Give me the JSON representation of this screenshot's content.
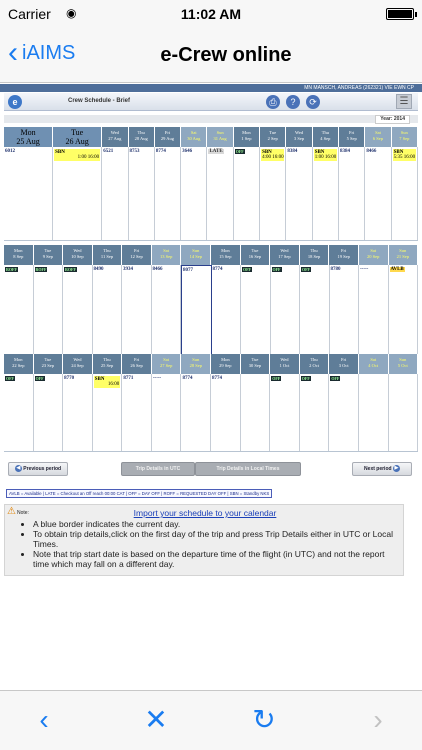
{
  "status": {
    "carrier": "Carrier",
    "time": "11:02 AM"
  },
  "nav": {
    "back_label": "iAIMS",
    "title": "e-Crew online"
  },
  "header": {
    "user_info": "MN MANSCH, ANDREAS (262321) VIE EWN CP",
    "page_title": "Crew Schedule - Brief",
    "year_label": "Year: 2014"
  },
  "weeks": [
    {
      "days": [
        {
          "d": "Mon",
          "date": "25 Aug",
          "duty": "6012",
          "type": "plain",
          "big": true
        },
        {
          "d": "Tue",
          "date": "26 Aug",
          "duty": "SBN",
          "t2": "1:00 16:00",
          "type": "sbn",
          "big": true
        },
        {
          "d": "Wed",
          "date": "27 Aug",
          "duty": "6521",
          "type": "plain"
        },
        {
          "d": "Thu",
          "date": "28 Aug",
          "duty": "8753",
          "type": "plain"
        },
        {
          "d": "Fri",
          "date": "29 Aug",
          "duty": "8774",
          "type": "plain"
        },
        {
          "d": "Sat",
          "date": "30 Aug",
          "duty": "3646",
          "type": "plain",
          "we": true
        },
        {
          "d": "Sun",
          "date": "31 Aug",
          "duty": "LATE",
          "type": "late",
          "we": true
        },
        {
          "d": "Mon",
          "date": "1 Sep",
          "duty": "OFF",
          "type": "off"
        },
        {
          "d": "Tue",
          "date": "2 Sep",
          "duty": "SBN",
          "t2": "4:00 16:00",
          "type": "sbn"
        },
        {
          "d": "Wed",
          "date": "3 Sep",
          "duty": "8384",
          "type": "plain"
        },
        {
          "d": "Thu",
          "date": "4 Sep",
          "duty": "SBN",
          "t2": "1:00 16:00",
          "type": "sbn"
        },
        {
          "d": "Fri",
          "date": "5 Sep",
          "duty": "8384",
          "type": "plain"
        },
        {
          "d": "Sat",
          "date": "6 Sep",
          "duty": "8466",
          "type": "plain",
          "we": true
        },
        {
          "d": "Sun",
          "date": "7 Sep",
          "duty": "SBN",
          "t2": "5:35 16:00",
          "type": "sbn",
          "we": true
        }
      ]
    },
    {
      "days": [
        {
          "d": "Mon",
          "date": "8 Sep",
          "duty": "ROFF",
          "type": "off"
        },
        {
          "d": "Tue",
          "date": "9 Sep",
          "duty": "ROFF",
          "type": "off"
        },
        {
          "d": "Wed",
          "date": "10 Sep",
          "duty": "ROFF",
          "type": "off"
        },
        {
          "d": "Thu",
          "date": "11 Sep",
          "duty": "8490",
          "type": "plain"
        },
        {
          "d": "Fri",
          "date": "12 Sep",
          "duty": "3934",
          "type": "plain"
        },
        {
          "d": "Sat",
          "date": "13 Sep",
          "duty": "8466",
          "type": "plain",
          "we": true
        },
        {
          "d": "Sun",
          "date": "14 Sep",
          "duty": "8077",
          "type": "plain",
          "we": true,
          "today": true
        },
        {
          "d": "Mon",
          "date": "15 Sep",
          "duty": "8774",
          "type": "plain"
        },
        {
          "d": "Tue",
          "date": "16 Sep",
          "duty": "OFF",
          "type": "off"
        },
        {
          "d": "Wed",
          "date": "17 Sep",
          "duty": "OFF",
          "type": "off"
        },
        {
          "d": "Thu",
          "date": "18 Sep",
          "duty": "OFF",
          "type": "off"
        },
        {
          "d": "Fri",
          "date": "19 Sep",
          "duty": "8780",
          "type": "plain"
        },
        {
          "d": "Sat",
          "date": "20 Sep",
          "duty": "-----",
          "type": "plain",
          "we": true
        },
        {
          "d": "Sun",
          "date": "21 Sep",
          "duty": "AVLB",
          "type": "avlb",
          "we": true
        }
      ]
    },
    {
      "days": [
        {
          "d": "Mon",
          "date": "22 Sep",
          "duty": "OFF",
          "type": "off"
        },
        {
          "d": "Tue",
          "date": "23 Sep",
          "duty": "OFF",
          "type": "off"
        },
        {
          "d": "Wed",
          "date": "24 Sep",
          "duty": "8770",
          "type": "plain"
        },
        {
          "d": "Thu",
          "date": "25 Sep",
          "duty": "SBN",
          "t2": "16:00",
          "type": "sbn"
        },
        {
          "d": "Fri",
          "date": "26 Sep",
          "duty": "8771",
          "type": "plain"
        },
        {
          "d": "Sat",
          "date": "27 Sep",
          "duty": "-----",
          "type": "plain",
          "we": true
        },
        {
          "d": "Sun",
          "date": "28 Sep",
          "duty": "8774",
          "type": "plain",
          "we": true
        },
        {
          "d": "Mon",
          "date": "29 Sep",
          "duty": "8774",
          "type": "plain"
        },
        {
          "d": "Tue",
          "date": "30 Sep",
          "duty": "",
          "type": "plain"
        },
        {
          "d": "Wed",
          "date": "1 Oct",
          "duty": "OFF",
          "type": "off"
        },
        {
          "d": "Thu",
          "date": "2 Oct",
          "duty": "OFF",
          "type": "off"
        },
        {
          "d": "Fri",
          "date": "3 Oct",
          "duty": "OFF",
          "type": "off"
        },
        {
          "d": "Sat",
          "date": "4 Oct",
          "duty": "",
          "type": "plain",
          "we": true
        },
        {
          "d": "Sun",
          "date": "5 Oct",
          "duty": "",
          "type": "plain",
          "we": true
        }
      ]
    }
  ],
  "buttons": {
    "previous": "Previous period",
    "trip_utc": "Trip Details in UTC",
    "trip_local": "Trip Details in Local Times",
    "next": "Next period"
  },
  "legend": "AVLB = Available | LATE = Checkout an Off reach 00:00 CAT | OFF = DAY OFF | ROFF = REQUESTED DAY OFF | SBN = Standby NKS",
  "notes": {
    "label": "Note:",
    "import_link": "Import your schedule to your calendar",
    "items": [
      "A blue border indicates the current day.",
      "To obtain trip details,click on the first day of the trip and press Trip Details either in UTC or Local Times.",
      "Note that trip start date is based on the departure time of the flight (in UTC) and not the report time which may fall on a different day."
    ]
  },
  "colors": {
    "accent": "#1a7cf0",
    "header_blue": "#5f7d98",
    "sbn_yellow": "#ffff66"
  }
}
